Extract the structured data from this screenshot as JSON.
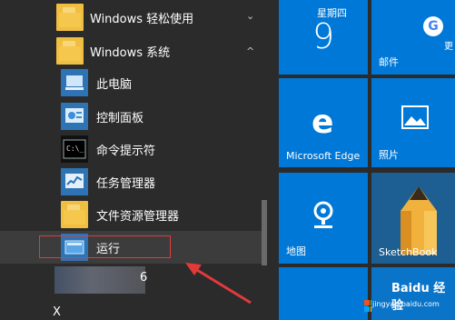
{
  "app_list": {
    "items": [
      {
        "label": "Windows 轻松使用",
        "type": "folder",
        "icon": "folder-icon",
        "expanded": false
      },
      {
        "label": "Windows 系统",
        "type": "folder",
        "icon": "folder-icon",
        "expanded": true
      },
      {
        "label": "此电脑",
        "type": "app",
        "icon": "computer-icon"
      },
      {
        "label": "控制面板",
        "type": "app",
        "icon": "control-panel-icon"
      },
      {
        "label": "命令提示符",
        "type": "app",
        "icon": "command-prompt-icon"
      },
      {
        "label": "任务管理器",
        "type": "app",
        "icon": "task-manager-icon"
      },
      {
        "label": "文件资源管理器",
        "type": "app",
        "icon": "file-explorer-icon"
      },
      {
        "label": "运行",
        "type": "app",
        "icon": "run-icon",
        "highlighted": true
      }
    ],
    "partial_item_suffix": "6",
    "partial_letter": "X",
    "chevron_collapsed": "⌄",
    "chevron_expanded": "^"
  },
  "tiles": {
    "calendar": {
      "weekday": "星期四",
      "day": "9"
    },
    "mail": {
      "label": "邮件",
      "extra_text": "更"
    },
    "edge": {
      "label": "Microsoft Edge"
    },
    "photos": {
      "label": "照片"
    },
    "maps": {
      "label": "地图"
    },
    "sketchbook": {
      "label": "SketchBook"
    },
    "watermark": {
      "text": "Baidu 经验",
      "subtext": "jingyan.baidu.com"
    }
  },
  "colors": {
    "tile": "#0078d7",
    "background": "#2b2b2b",
    "highlight_border": "#e23a3a",
    "arrow": "#e23a3a",
    "folder": "#f0bf42"
  }
}
